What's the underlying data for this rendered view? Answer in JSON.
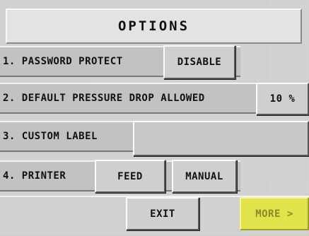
{
  "header": {
    "title": "OPTIONS"
  },
  "options": {
    "password_protect": {
      "label": "1. PASSWORD PROTECT",
      "button": "DISABLE"
    },
    "pressure_drop": {
      "label": "2. DEFAULT PRESSURE DROP ALLOWED",
      "button": "10 %"
    },
    "custom_label": {
      "label": "3. CUSTOM LABEL",
      "value": ""
    },
    "printer": {
      "label": "4. PRINTER",
      "feed_button": "FEED",
      "manual_button": "MANUAL"
    }
  },
  "footer": {
    "exit": "EXIT",
    "more": "MORE >"
  },
  "colors": {
    "background": "#d9d9d9",
    "row": "#c2c2c2",
    "more_button": "#e2e24a"
  }
}
